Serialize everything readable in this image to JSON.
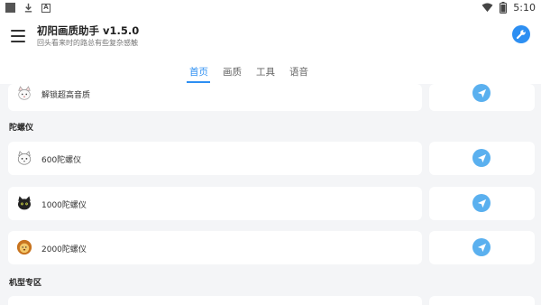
{
  "status_bar": {
    "time": "5:10",
    "icons": [
      "stop-icon",
      "download-icon",
      "font-icon",
      "wifi-icon",
      "battery-icon"
    ]
  },
  "app": {
    "title": "初阳画质助手 v1.5.0",
    "subtitle": "回头看来时的路总有些复杂感触",
    "accent_color": "#2d8ff2",
    "icons": [
      "menu-icon",
      "wrench-icon"
    ]
  },
  "tabs": [
    {
      "label": "首页",
      "active": true
    },
    {
      "label": "画质",
      "active": false
    },
    {
      "label": "工具",
      "active": false
    },
    {
      "label": "语音",
      "active": false
    }
  ],
  "sections": [
    {
      "title": "陀螺仪"
    },
    {
      "title": "机型专区"
    }
  ],
  "items": [
    {
      "label": "解锁超高音质",
      "icon": "white-cat-icon"
    },
    {
      "label": "600陀螺仪",
      "icon": "cat-face-icon"
    },
    {
      "label": "1000陀螺仪",
      "icon": "black-cat-icon"
    },
    {
      "label": "2000陀螺仪",
      "icon": "lion-icon"
    }
  ],
  "action_icon": "send-icon",
  "action_color": "#5ab0ef"
}
